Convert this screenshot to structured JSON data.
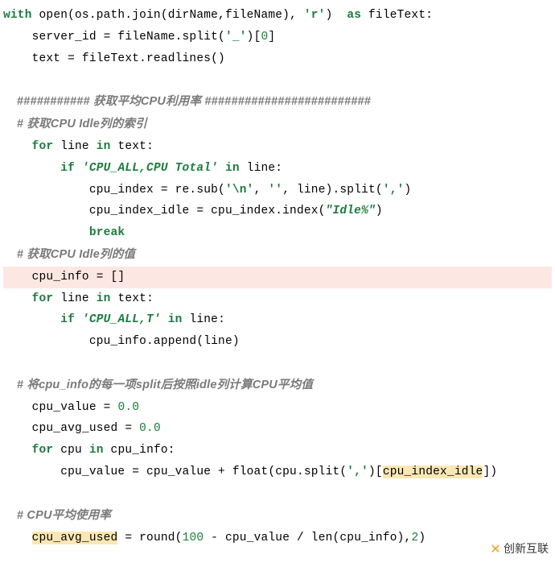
{
  "code": {
    "l1a": "with",
    "l1b": " open(os.path.join(dirName,fileName), ",
    "l1c": "'r'",
    "l1d": ")  ",
    "l1e": "as",
    "l1f": " fileText:",
    "l2a": "    server_id = fileName.split(",
    "l2b": "'_'",
    "l2c": ")[",
    "l2d": "0",
    "l2e": "]",
    "l3": "    text = fileText.readlines()",
    "blank1": "",
    "c1": "    ########### 获取平均CPU利用率 #########################",
    "c2": "    # 获取CPU Idle列的索引",
    "l4a": "    ",
    "l4b": "for",
    "l4c": " line ",
    "l4d": "in",
    "l4e": " text:",
    "l5a": "        ",
    "l5b": "if",
    "l5c": " ",
    "l5d": "'CPU_ALL,CPU Total'",
    "l5e": " ",
    "l5f": "in",
    "l5g": " line:",
    "l6a": "            cpu_index = re.sub(",
    "l6b": "'\\n'",
    "l6c": ", ",
    "l6d": "''",
    "l6e": ", line).split(",
    "l6f": "','",
    "l6g": ")",
    "l7a": "            cpu_index_idle = cpu_index.index(",
    "l7b": "\"Idle%\"",
    "l7c": ")",
    "l8a": "            ",
    "l8b": "break",
    "c3": "    # 获取CPU Idle列的值",
    "l9": "    cpu_info = []",
    "l10a": "    ",
    "l10b": "for",
    "l10c": " line ",
    "l10d": "in",
    "l10e": " text:",
    "l11a": "        ",
    "l11b": "if",
    "l11c": " ",
    "l11d": "'CPU_ALL,T'",
    "l11e": " ",
    "l11f": "in",
    "l11g": " line:",
    "l12": "            cpu_info.append(line)",
    "blank2": "",
    "c4": "    # 将cpu_info的每一项split后按照idle列计算CPU平均值",
    "l13a": "    cpu_value = ",
    "l13b": "0.0",
    "l14a": "    cpu_avg_used = ",
    "l14b": "0.0",
    "l15a": "    ",
    "l15b": "for",
    "l15c": " cpu ",
    "l15d": "in",
    "l15e": " cpu_info:",
    "l16a": "        cpu_value = cpu_value + float(cpu.split(",
    "l16b": "','",
    "l16c": ")[",
    "l16d": "cpu_index_idle",
    "l16e": "])",
    "blank3": "",
    "c5": "    # CPU平均使用率",
    "l17a": "    ",
    "l17b": "cpu_avg_used",
    "l17c": " = round(",
    "l17d": "100",
    "l17e": " - cpu_value / len(cpu_info),",
    "l17f": "2",
    "l17g": ")"
  },
  "logo": {
    "glyph": "✕",
    "text": "创新互联"
  }
}
